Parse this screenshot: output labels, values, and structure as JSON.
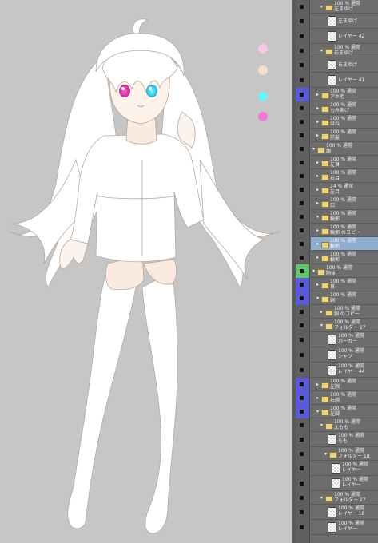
{
  "colors": {
    "canvas_bg": "#c6c6c6",
    "panel_bg": "#6d6d6d",
    "blue_tag": "#5a5ad8",
    "green_tag": "#5fc46a",
    "selected": "#8faed0"
  },
  "swatches": [
    {
      "name": "pink-light",
      "color": "#f6c6e8"
    },
    {
      "name": "peach",
      "color": "#f4dcd2"
    },
    {
      "name": "cyan",
      "color": "#6cf2f0"
    },
    {
      "name": "pink",
      "color": "#f07ad2"
    }
  ],
  "layers": [
    {
      "kind": "folder",
      "mode": "100 % 通常",
      "name": "左まゆげ",
      "indent": 2,
      "open": true
    },
    {
      "kind": "layer",
      "mode": "",
      "name": "左まゆげ",
      "indent": 3
    },
    {
      "kind": "layer",
      "mode": "",
      "name": "レイヤー 42",
      "indent": 3
    },
    {
      "kind": "folder",
      "mode": "100 % 通常",
      "name": "右まゆげ",
      "indent": 2,
      "open": true
    },
    {
      "kind": "layer",
      "mode": "",
      "name": "右まゆげ",
      "indent": 3
    },
    {
      "kind": "layer",
      "mode": "",
      "name": "レイヤー 41",
      "indent": 3
    },
    {
      "kind": "folder",
      "mode": "100 % 通常",
      "name": "アホ毛",
      "indent": 1,
      "open": false,
      "tag": "blue"
    },
    {
      "kind": "folder",
      "mode": "100 % 通常",
      "name": "もみあげ",
      "indent": 1,
      "open": false
    },
    {
      "kind": "folder",
      "mode": "100 % 通常",
      "name": "はね",
      "indent": 1,
      "open": false
    },
    {
      "kind": "folder",
      "mode": "100 % 通常",
      "name": "前髪",
      "indent": 1,
      "open": false
    },
    {
      "kind": "folder",
      "mode": "100 % 通常",
      "name": "顔",
      "indent": 0,
      "open": true
    },
    {
      "kind": "folder",
      "mode": "100 % 通常",
      "name": "左目",
      "indent": 1,
      "open": false
    },
    {
      "kind": "folder",
      "mode": "100 % 通常",
      "name": "右目",
      "indent": 1,
      "open": false
    },
    {
      "kind": "folder",
      "mode": "24 % 通常",
      "name": "左目",
      "indent": 1,
      "open": false
    },
    {
      "kind": "folder",
      "mode": "100 % 通常",
      "name": "口",
      "indent": 1,
      "open": false
    },
    {
      "kind": "folder",
      "mode": "100 % 通常",
      "name": "輪郭",
      "indent": 1,
      "open": true
    },
    {
      "kind": "folder",
      "mode": "100 % 通常",
      "name": "輪郭 のコピー",
      "indent": 1,
      "open": false
    },
    {
      "kind": "folder",
      "mode": "100 % 通常",
      "name": "輪郭",
      "indent": 1,
      "open": false,
      "selected": true
    },
    {
      "kind": "folder",
      "mode": "100 % 通常",
      "name": "輪郭",
      "indent": 1,
      "open": false
    },
    {
      "kind": "folder",
      "mode": "100 % 通常",
      "name": "胴体",
      "indent": 0,
      "open": true,
      "tag": "green"
    },
    {
      "kind": "folder",
      "mode": "100 % 通常",
      "name": "首",
      "indent": 1,
      "open": false,
      "tag": "blue"
    },
    {
      "kind": "folder",
      "mode": "100 % 通常",
      "name": "胴",
      "indent": 1,
      "open": true,
      "tag": "blue"
    },
    {
      "kind": "folder",
      "mode": "100 % 通常",
      "name": "胴 のコピー",
      "indent": 2,
      "open": false
    },
    {
      "kind": "folder",
      "mode": "100 % 通常",
      "name": "フォルダー 17",
      "indent": 2,
      "open": true
    },
    {
      "kind": "layer",
      "mode": "100 % 通常",
      "name": "パーカー",
      "indent": 3
    },
    {
      "kind": "layer",
      "mode": "100 % 通常",
      "name": "シャツ",
      "indent": 3
    },
    {
      "kind": "layer",
      "mode": "100 % 通常",
      "name": "レイヤー 44",
      "indent": 3
    },
    {
      "kind": "folder",
      "mode": "100 % 通常",
      "name": "左腕",
      "indent": 1,
      "open": false,
      "tag": "blue"
    },
    {
      "kind": "folder",
      "mode": "100 % 通常",
      "name": "右腕",
      "indent": 1,
      "open": false,
      "tag": "blue"
    },
    {
      "kind": "folder",
      "mode": "100 % 通常",
      "name": "左脚",
      "indent": 1,
      "open": true,
      "tag": "blue"
    },
    {
      "kind": "folder",
      "mode": "100 % 通常",
      "name": "太もも",
      "indent": 2,
      "open": true
    },
    {
      "kind": "layer",
      "mode": "100 % 通常",
      "name": "もも",
      "indent": 3
    },
    {
      "kind": "folder",
      "mode": "100 % 通常",
      "name": "フォルダー 18",
      "indent": 3,
      "open": true
    },
    {
      "kind": "layer",
      "mode": "100 % 通常",
      "name": "レイヤー",
      "indent": 4
    },
    {
      "kind": "layer",
      "mode": "100 % 通常",
      "name": "レイヤー",
      "indent": 4
    },
    {
      "kind": "folder",
      "mode": "100 % 通常",
      "name": "フォルダー 27",
      "indent": 2,
      "open": true
    },
    {
      "kind": "layer",
      "mode": "100 % 通常",
      "name": "レイヤー 18",
      "indent": 3
    },
    {
      "kind": "layer",
      "mode": "100 % 通常",
      "name": "レイヤー",
      "indent": 3
    }
  ]
}
